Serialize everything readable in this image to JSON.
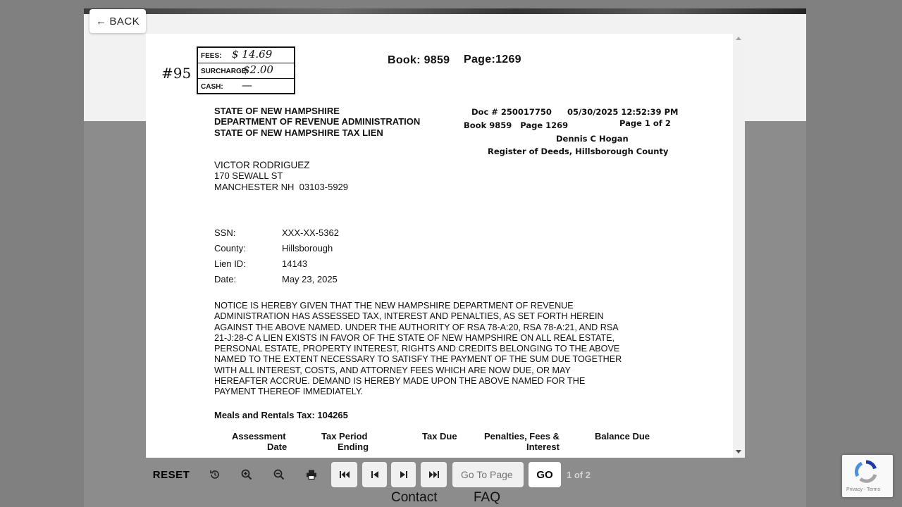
{
  "nav": {
    "back_label": "BACK"
  },
  "document": {
    "handwritten_number": "#95",
    "stamp": [
      {
        "label": "FEES:",
        "value": "$ 14.69"
      },
      {
        "label": "SURCHARGE:",
        "value": "$2.00"
      },
      {
        "label": "CASH:",
        "value": "—"
      }
    ],
    "book_label": "Book: 9859",
    "page_label": "Page:1269",
    "header_left": [
      "STATE OF NEW HAMPSHIRE",
      "DEPARTMENT OF REVENUE ADMINISTRATION",
      "STATE OF NEW HAMPSHIRE TAX LIEN"
    ],
    "doc_number": "Doc # 250017750",
    "doc_datetime": "05/30/2025 12:52:39 PM",
    "doc_book_page": "Book 9859   Page 1269",
    "doc_page_of": "Page 1 of 2",
    "register_name": "Dennis C Hogan",
    "register_title": "Register of Deeds, Hillsborough County",
    "address": [
      "VICTOR RODRIGUEZ",
      "170 SEWALL ST",
      "MANCHESTER NH  03103-5929"
    ],
    "fields": [
      {
        "label": "SSN:",
        "value": "XXX-XX-5362"
      },
      {
        "label": "County:",
        "value": "Hillsborough"
      },
      {
        "label": "Lien ID:",
        "value": "14143"
      },
      {
        "label": "Date:",
        "value": "May 23, 2025"
      }
    ],
    "notice_lines": [
      "NOTICE IS HEREBY GIVEN THAT THE NEW HAMPSHIRE DEPARTMENT OF REVENUE",
      "ADMINISTRATION HAS ASSESSED TAX, INTEREST AND PENALTIES, AS SET FORTH HEREIN",
      "AGAINST THE ABOVE NAMED. UNDER THE AUTHORITY OF RSA 78-A:20, RSA 78-A:21, AND RSA",
      "21-J:28-C A LIEN EXISTS IN FAVOR OF THE STATE OF NEW HAMPSHIRE ON ALL REAL ESTATE,",
      "PERSONAL ESTATE, PROPERTY INTEREST, RIGHTS AND CREDITS BELONGING TO THE ABOVE",
      "NAMED TO THE EXTENT NECESSARY TO SATISFY THE PAYMENT OF THE SUM DUE TOGETHER",
      "WITH ALL INTEREST, COSTS, AND ATTORNEY FEES WHICH ARE NOW DUE, OR MAY",
      "HEREAFTER ACCRUE. DEMAND IS HEREBY MADE UPON THE ABOVE NAMED FOR THE",
      "PAYMENT THEREOF IMMEDIATELY."
    ],
    "tax_heading": "Meals and Rentals Tax: 104265",
    "table_headers": {
      "assessment_1": "Assessment",
      "assessment_2": "Date",
      "period_1": "Tax Period",
      "period_2": "Ending",
      "tax_due": "Tax Due",
      "penalties_1": "Penalties, Fees &",
      "penalties_2": "Interest",
      "balance": "Balance Due"
    }
  },
  "toolbar": {
    "reset_label": "RESET",
    "goto_placeholder": "Go To Page",
    "go_label": "GO",
    "page_indicator": "1 of 2"
  },
  "footer": {
    "contact": "Contact",
    "faq": "FAQ"
  },
  "recaptcha": {
    "text": "Privacy - Terms"
  }
}
